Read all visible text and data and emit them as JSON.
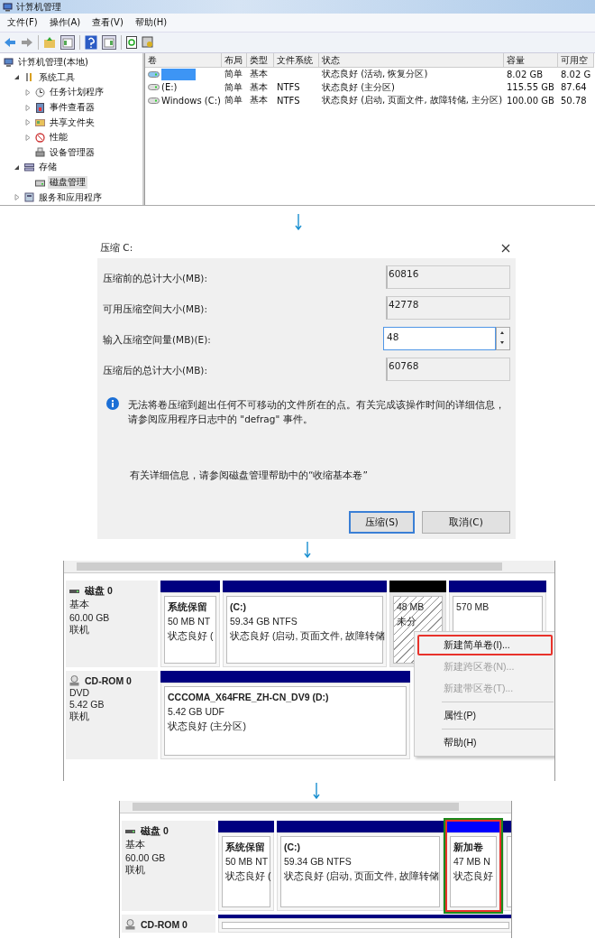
{
  "computer_management": {
    "window": {
      "title": "计算机管理"
    },
    "menu": [
      "文件(F)",
      "操作(A)",
      "查看(V)",
      "帮助(H)"
    ],
    "tree": [
      {
        "label": "计算机管理(本地)",
        "selected": false,
        "children": [
          {
            "label": "系统工具",
            "expanded": true,
            "selected": false,
            "children": [
              {
                "label": "任务计划程序",
                "expanded": false,
                "selected": false
              },
              {
                "label": "事件查看器",
                "expanded": false,
                "selected": false
              },
              {
                "label": "共享文件夹",
                "expanded": false,
                "selected": false
              },
              {
                "label": "性能",
                "expanded": false,
                "selected": false
              },
              {
                "label": "设备管理器",
                "selected": false
              }
            ]
          },
          {
            "label": "存储",
            "expanded": true,
            "selected": false,
            "children": [
              {
                "label": "磁盘管理",
                "selected": true
              }
            ]
          },
          {
            "label": "服务和应用程序",
            "expanded": false,
            "selected": false
          }
        ]
      }
    ],
    "table": {
      "columns": [
        "卷",
        "布局",
        "类型",
        "文件系统",
        "状态",
        "容量",
        "可用空"
      ],
      "rows": [
        {
          "volume_redacted": true,
          "layout": "简单",
          "type": "基本",
          "status": "状态良好 (活动, 恢复分区)",
          "capacity": "8.02 GB",
          "free": "8.02 G"
        },
        {
          "volume": "(E:)",
          "layout": "简单",
          "type": "基本",
          "file_system": "NTFS",
          "status": "状态良好 (主分区)",
          "capacity": "115.55 GB",
          "free": "87.64"
        },
        {
          "volume": "Windows (C:)",
          "layout": "简单",
          "type": "基本",
          "file_system": "NTFS",
          "status": "状态良好 (启动, 页面文件, 故障转储, 主分区)",
          "capacity": "100.00 GB",
          "free": "50.78"
        }
      ]
    }
  },
  "shrink_dialog": {
    "title": "压缩 C:",
    "fields": [
      {
        "label": "压缩前的总计大小(MB):",
        "value": "60816",
        "kind": "readonly"
      },
      {
        "label": "可用压缩空间大小(MB):",
        "value": "42778",
        "kind": "readonly"
      },
      {
        "label": "输入压缩空间量(MB)(E):",
        "value": "48",
        "kind": "spin"
      },
      {
        "label": "压缩后的总计大小(MB):",
        "value": "60768",
        "kind": "readonly"
      }
    ],
    "info": "无法将卷压缩到超出任何不可移动的文件所在的点。有关完成该操作时间的详细信息，请参阅应用程序日志中的 \"defrag\" 事件。",
    "help": "有关详细信息，请参阅磁盘管理帮助中的“收缩基本卷”",
    "buttons": [
      {
        "label": "压缩(S)",
        "default": true
      },
      {
        "label": "取消(C)",
        "default": false
      }
    ]
  },
  "disk_view_before": {
    "disks": [
      {
        "kind": "disk",
        "name": "磁盘 0",
        "type": "基本",
        "size": "60.00 GB",
        "state": "联机",
        "partitions": [
          {
            "kind": "primary",
            "name": "系统保留",
            "size": "50 MB NT",
            "status": "状态良好 (",
            "highlighted": false
          },
          {
            "kind": "primary",
            "name": "(C:)",
            "size": "59.34 GB NTFS",
            "status": "状态良好 (启动, 页面文件, 故障转储",
            "highlighted": false
          },
          {
            "kind": "unallocated",
            "size": "48 MB",
            "status": "未分",
            "highlighted": false
          },
          {
            "kind": "primary",
            "size": "570 MB",
            "highlighted": false
          }
        ]
      },
      {
        "kind": "cdrom",
        "name": "CD-ROM 0",
        "type": "DVD",
        "size": "5.42 GB",
        "state": "联机",
        "partitions": [
          {
            "kind": "primary",
            "name": "CCCOMA_X64FRE_ZH-CN_DV9  (D:)",
            "size": "5.42 GB UDF",
            "status": "状态良好 (主分区)",
            "highlighted": false
          }
        ]
      }
    ],
    "context_menu": [
      {
        "items": [
          {
            "label": "新建简单卷(I)...",
            "disabled": false,
            "highlighted": true
          },
          {
            "label": "新建跨区卷(N)...",
            "disabled": true,
            "highlighted": false
          },
          {
            "label": "新建带区卷(T)...",
            "disabled": true,
            "highlighted": false
          }
        ]
      },
      {
        "items": [
          {
            "label": "属性(P)",
            "disabled": false,
            "highlighted": false
          }
        ]
      },
      {
        "items": [
          {
            "label": "帮助(H)",
            "disabled": false,
            "highlighted": false
          }
        ]
      }
    ]
  },
  "disk_view_after": {
    "disks": [
      {
        "kind": "disk",
        "name": "磁盘 0",
        "type": "基本",
        "size": "60.00 GB",
        "state": "联机",
        "partitions": [
          {
            "kind": "primary",
            "name": "系统保留",
            "size": "50 MB NT",
            "status": "状态良好 (",
            "highlighted": false
          },
          {
            "kind": "primary",
            "name": "(C:)",
            "size": "59.34 GB NTFS",
            "status": "状态良好 (启动, 页面文件, 故障转储",
            "highlighted": false
          },
          {
            "kind": "new",
            "name": "新加卷",
            "size": "47 MB N",
            "status": "状态良好",
            "highlighted": true
          },
          {
            "kind": "primary",
            "highlighted": false
          }
        ]
      },
      {
        "kind": "cdrom",
        "name": "CD-ROM 0",
        "partitions": [
          {
            "kind": "primary",
            "highlighted": false
          }
        ]
      }
    ]
  }
}
